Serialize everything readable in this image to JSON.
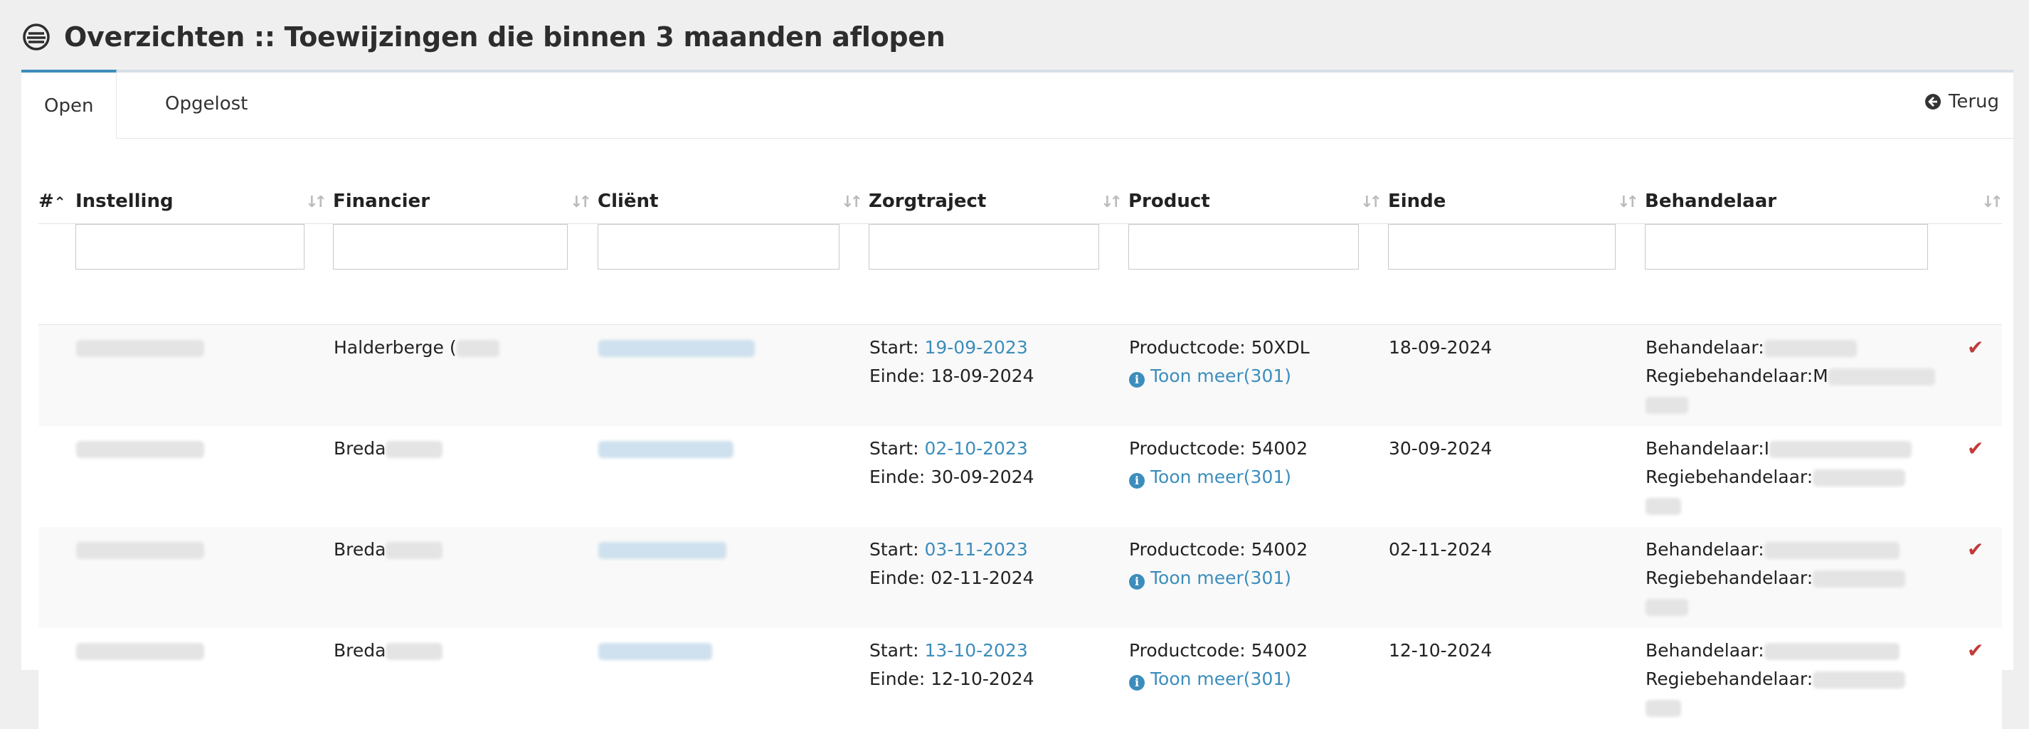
{
  "header": {
    "title": "Overzichten :: Toewijzingen die binnen 3 maanden aflopen",
    "icon": "overview-icon"
  },
  "tabs": [
    {
      "label": "Open",
      "active": true
    },
    {
      "label": "Opgelost",
      "active": false
    }
  ],
  "back": {
    "label": "Terug",
    "icon": "arrow-left-circle-icon"
  },
  "columns": {
    "num": "#",
    "instelling": "Instelling",
    "financier": "Financier",
    "client": "Cliënt",
    "zorgtraject": "Zorgtraject",
    "product": "Product",
    "einde": "Einde",
    "behandelaar": "Behandelaar"
  },
  "labels": {
    "start": "Start: ",
    "einde": "Einde: ",
    "toon_meer": "Toon meer(301)",
    "behandelaar": "Behandelaar:",
    "regiebehandelaar": "Regiebehandelaar:"
  },
  "rows": [
    {
      "financier": "Halderberge (",
      "start": "19-09-2023",
      "einde_traject": "18-09-2024",
      "productcode": "Productcode: 50XDL",
      "einde": "18-09-2024",
      "behandelaar_prefix": "Behandelaar:",
      "regie_prefix": "Regiebehandelaar:M"
    },
    {
      "financier": "Breda",
      "start": "02-10-2023",
      "einde_traject": "30-09-2024",
      "productcode": "Productcode: 54002",
      "einde": "30-09-2024",
      "behandelaar_prefix": "Behandelaar:I",
      "regie_prefix": "Regiebehandelaar:"
    },
    {
      "financier": "Breda",
      "start": "03-11-2023",
      "einde_traject": "02-11-2024",
      "productcode": "Productcode: 54002",
      "einde": "02-11-2024",
      "behandelaar_prefix": "Behandelaar:",
      "regie_prefix": "Regiebehandelaar:"
    },
    {
      "financier": "Breda",
      "start": "13-10-2023",
      "einde_traject": "12-10-2024",
      "productcode": "Productcode: 54002",
      "einde": "12-10-2024",
      "behandelaar_prefix": "Behandelaar:",
      "regie_prefix": "Regiebehandelaar:"
    }
  ],
  "colors": {
    "accent": "#3c8dbc",
    "check": "#c23a3a"
  }
}
